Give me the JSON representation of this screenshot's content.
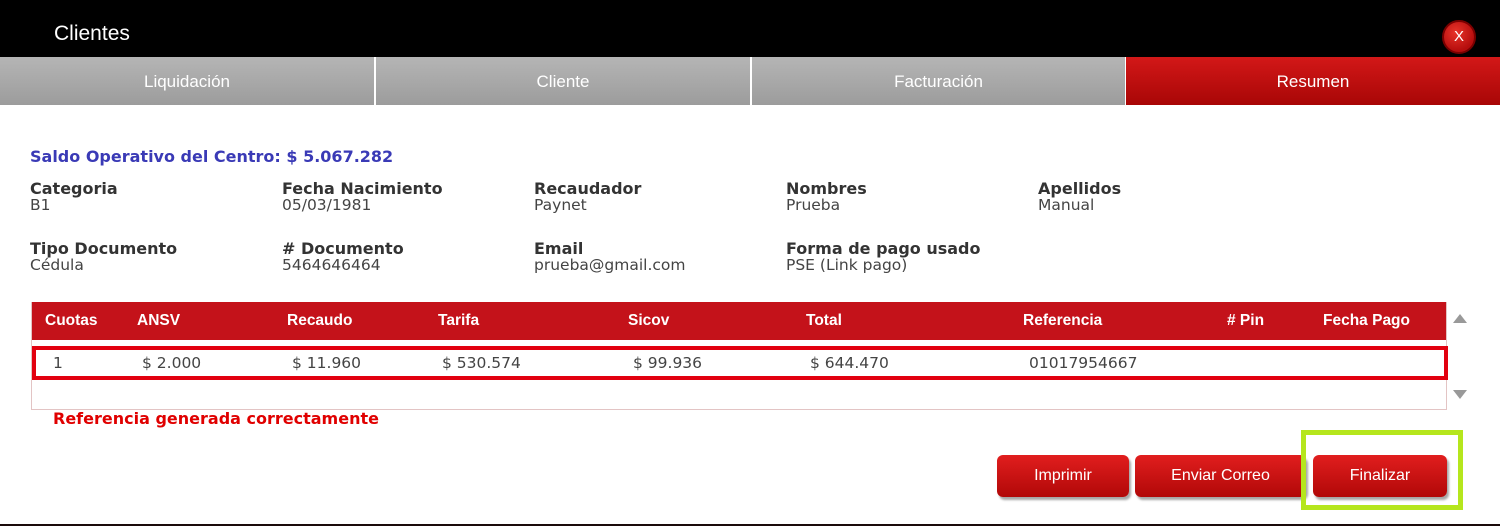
{
  "window": {
    "title": "Clientes",
    "close_label": "X"
  },
  "tabs": [
    {
      "label": "Liquidación"
    },
    {
      "label": "Cliente"
    },
    {
      "label": "Facturación"
    },
    {
      "label": "Resumen",
      "active": true
    }
  ],
  "saldo": "Saldo Operativo del Centro: $ 5.067.282",
  "fields": {
    "categoria": {
      "label": "Categoria",
      "value": "B1"
    },
    "fecha_nacimiento": {
      "label": "Fecha Nacimiento",
      "value": "05/03/1981"
    },
    "recaudador": {
      "label": "Recaudador",
      "value": "Paynet"
    },
    "nombres": {
      "label": "Nombres",
      "value": "Prueba"
    },
    "apellidos": {
      "label": "Apellidos",
      "value": "Manual"
    },
    "tipo_documento": {
      "label": "Tipo Documento",
      "value": "Cédula"
    },
    "documento": {
      "label": "# Documento",
      "value": "5464646464"
    },
    "email": {
      "label": "Email",
      "value": "prueba@gmail.com"
    },
    "forma_pago": {
      "label": "Forma de pago usado",
      "value": "PSE (Link pago)"
    }
  },
  "table": {
    "headers": [
      "Cuotas",
      "ANSV",
      "Recaudo",
      "Tarifa",
      "Sicov",
      "Total",
      "Referencia",
      "# Pin",
      "Fecha Pago"
    ],
    "rows": [
      [
        "1",
        "$ 2.000",
        "$ 11.960",
        "$ 530.574",
        "$ 99.936",
        "$ 644.470",
        "01017954667",
        "",
        ""
      ]
    ]
  },
  "message": "Referencia generada correctamente",
  "buttons": {
    "imprimir": "Imprimir",
    "enviar_correo": "Enviar Correo",
    "finalizar": "Finalizar"
  },
  "colors": {
    "accent": "#c4121a",
    "saldo": "#3a3ab6",
    "highlight": "#b5e61d",
    "message": "#e00000"
  }
}
